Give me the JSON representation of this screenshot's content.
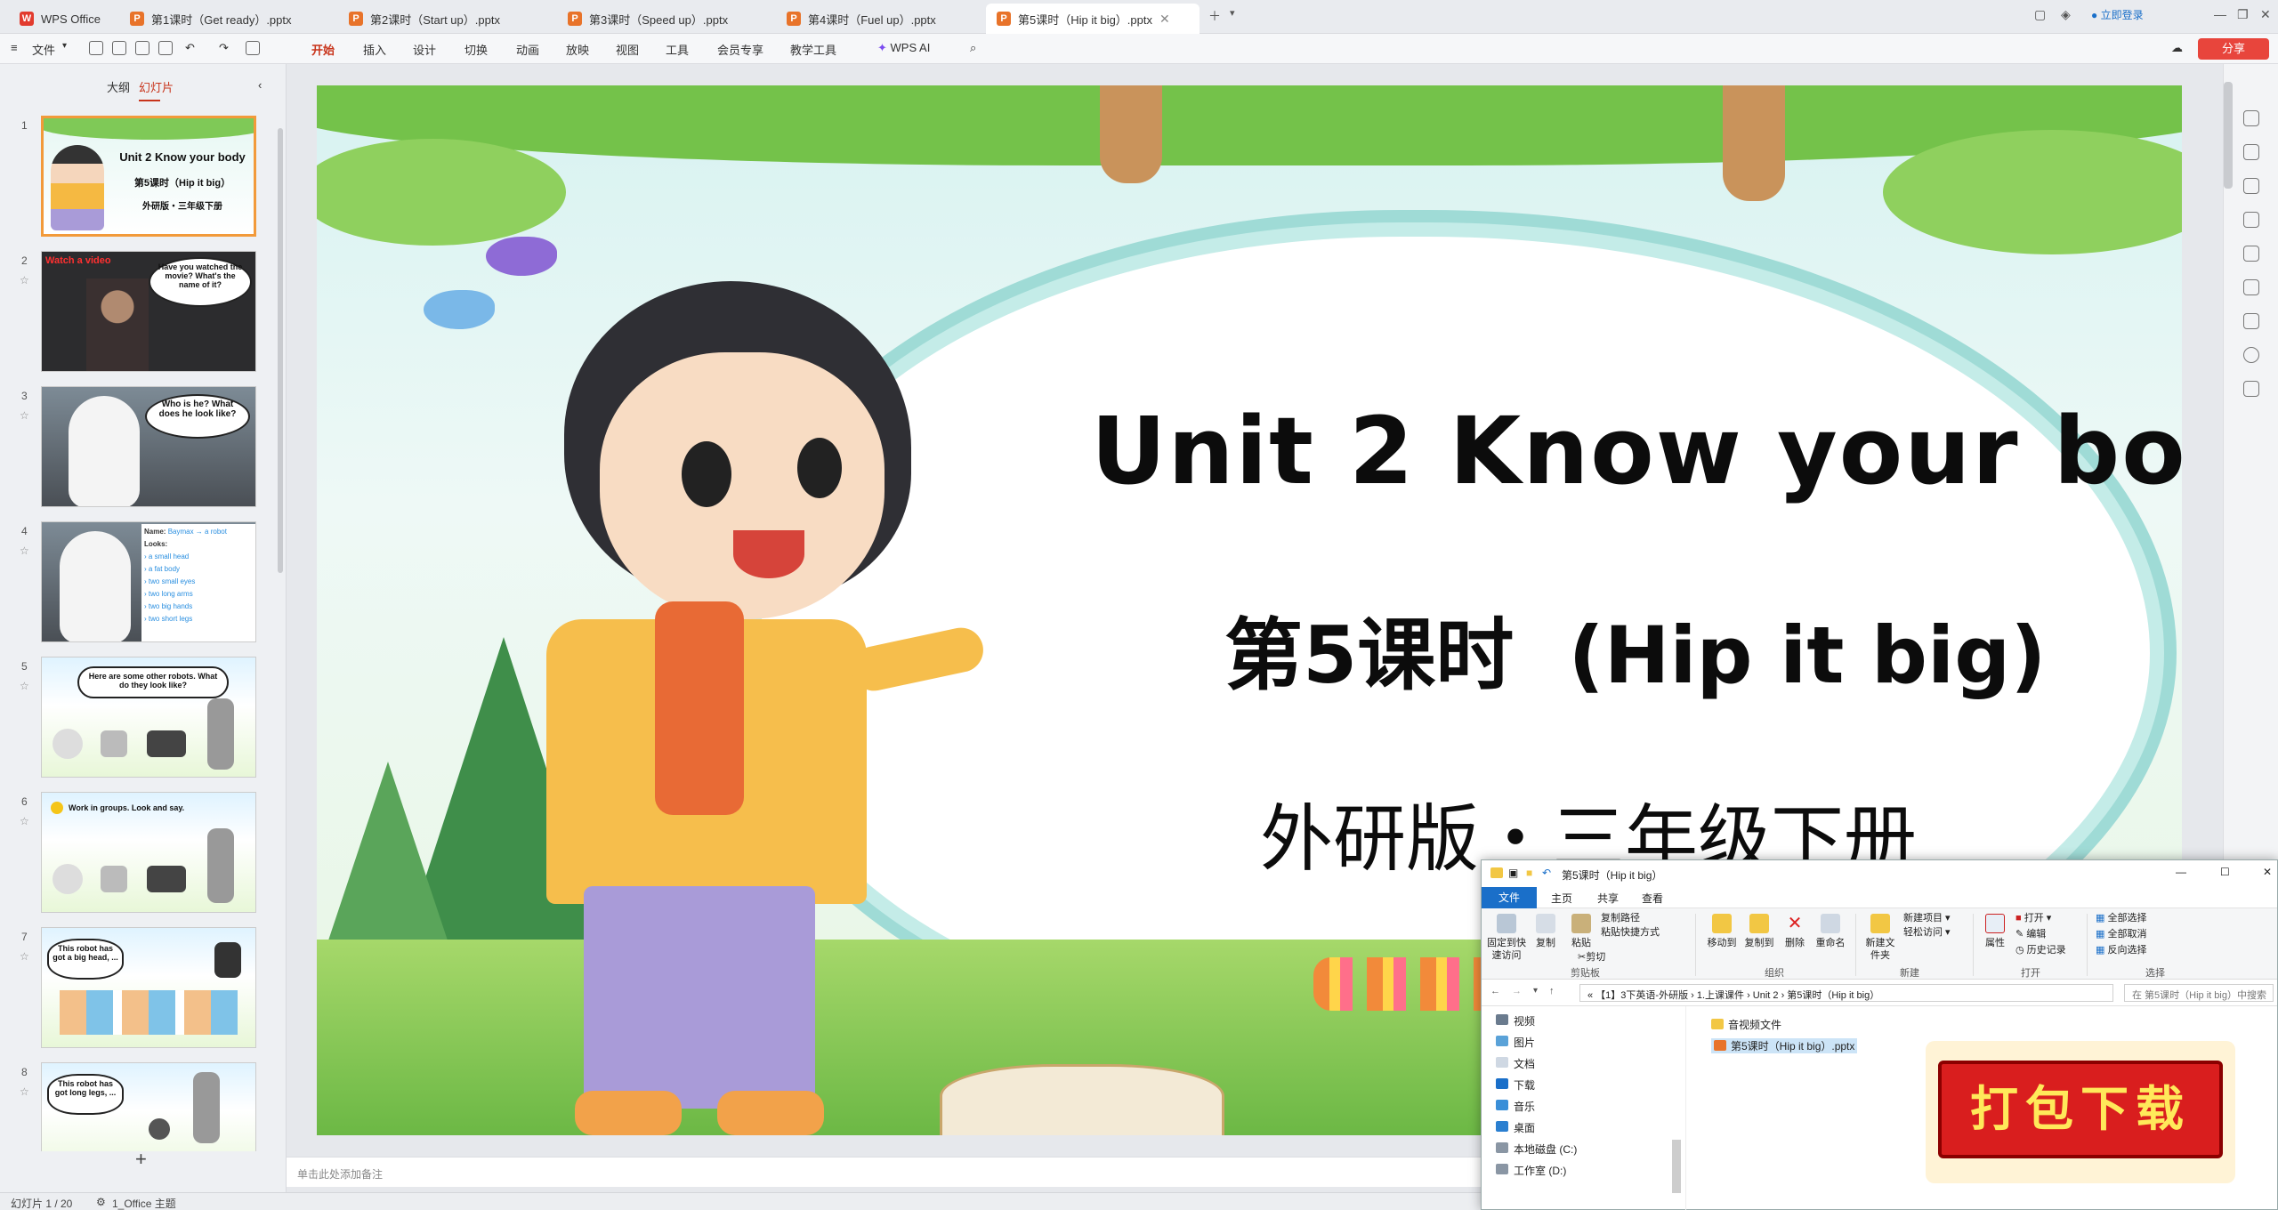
{
  "tabs": [
    {
      "label": "WPS Office"
    },
    {
      "label": "第1课时（Get ready）.pptx"
    },
    {
      "label": "第2课时（Start up）.pptx"
    },
    {
      "label": "第3课时（Speed up）.pptx"
    },
    {
      "label": "第4课时（Fuel up）.pptx"
    },
    {
      "label": "第5课时（Hip it big）.pptx"
    }
  ],
  "login": "立即登录",
  "menu": {
    "file": "文件",
    "items": [
      "开始",
      "插入",
      "设计",
      "切换",
      "动画",
      "放映",
      "视图",
      "工具",
      "会员专享",
      "教学工具",
      "WPS AI"
    ],
    "share": "分享"
  },
  "panel": {
    "outline": "大纲",
    "slides": "幻灯片"
  },
  "thumbs": [
    {
      "num": "1",
      "t1": "Unit 2 Know your body",
      "t2": "第5课时（Hip it big）",
      "t3": "外研版・三年级下册"
    },
    {
      "num": "2",
      "tag": "Watch a video",
      "bubble": "Have you watched the movie? What's the name of it?"
    },
    {
      "num": "3",
      "bubble": "Who is he? What does he look like?"
    },
    {
      "num": "4",
      "name": "Name:",
      "nameval": "Baymax → a robot",
      "looks": "Looks:",
      "items": [
        "a small head",
        "a fat body",
        "two small eyes",
        "two long arms",
        "two big hands",
        "two short legs"
      ]
    },
    {
      "num": "5",
      "text": "Here are some other robots. What do they look like?"
    },
    {
      "num": "6",
      "text": "Work in groups. Look and say."
    },
    {
      "num": "7",
      "bubble": "This robot has got a big head, ..."
    },
    {
      "num": "8",
      "bubble": "This robot has got long legs, ..."
    }
  ],
  "slide": {
    "title": "Unit 2 Know your body",
    "subtitle_cn": "第5课时",
    "subtitle_en": "(Hip it big)",
    "edition": "外研版・三年级下册"
  },
  "notes": "单击此处添加备注",
  "status": {
    "slide": "幻灯片 1 / 20",
    "theme": "1_Office 主题"
  },
  "explorer": {
    "title": "第5课时（Hip it big）",
    "tabs": [
      "文件",
      "主页",
      "共享",
      "查看"
    ],
    "ribbon": {
      "pin": "固定到快速访问",
      "copy": "复制",
      "paste": "粘贴",
      "copypath": "复制路径",
      "pasteshortcut": "粘贴快捷方式",
      "cut": "剪切",
      "moveto": "移动到",
      "copyto": "复制到",
      "delete": "删除",
      "rename": "重命名",
      "newfolder": "新建文件夹",
      "newitem": "新建项目",
      "easyaccess": "轻松访问",
      "properties": "属性",
      "open": "打开",
      "edit": "编辑",
      "history": "历史记录",
      "selectall": "全部选择",
      "selectnone": "全部取消",
      "invert": "反向选择"
    },
    "groups": [
      "剪贴板",
      "组织",
      "新建",
      "打开",
      "选择"
    ],
    "address": "« 【1】3下英语-外研版 › 1.上课课件 › Unit 2 › 第5课时（Hip it big）",
    "search": "在 第5课时（Hip it big）中搜索",
    "nav": [
      "视频",
      "图片",
      "文档",
      "下载",
      "音乐",
      "桌面",
      "本地磁盘 (C:)",
      "工作室 (D:)"
    ],
    "files": [
      "音视频文件",
      "第5课时（Hip it big）.pptx"
    ]
  },
  "download": "打包下载"
}
